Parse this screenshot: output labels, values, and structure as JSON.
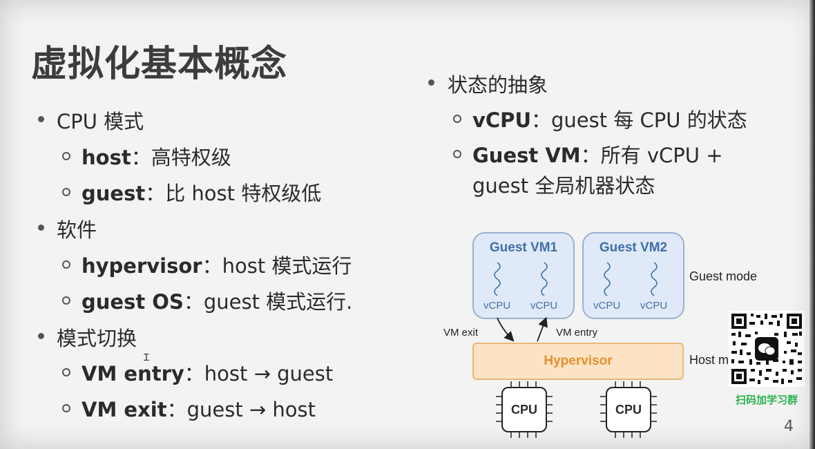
{
  "title": "虚拟化基本概念",
  "left_list": {
    "cpu_mode": "CPU 模式",
    "host_term": "host",
    "host_desc": "：高特权级",
    "guest_term": "guest",
    "guest_desc": "：比 host 特权级低",
    "software": "软件",
    "hypervisor_term": "hypervisor",
    "hypervisor_desc": "：host 模式运行",
    "guestos_term": "guest OS",
    "guestos_desc": "：guest 模式运行.",
    "mode_switch": "模式切换",
    "vmentry_term": "VM entry",
    "vmentry_desc": "：host → guest",
    "vmexit_term": "VM exit",
    "vmexit_desc": "：guest → host"
  },
  "right_list": {
    "state_abstraction": "状态的抽象",
    "vcpu_term": "vCPU",
    "vcpu_desc": "：guest 每 CPU 的状态",
    "guestvm_term": "Guest VM",
    "guestvm_desc": "：所有 vCPU +",
    "guestvm_desc2": "guest 全局机器状态"
  },
  "diagram": {
    "vm1": "Guest VM1",
    "vm2": "Guest VM2",
    "vcpu": "vCPU",
    "guest_mode": "Guest mode",
    "host_mode": "Host m",
    "vm_exit": "VM exit",
    "vm_entry": "VM entry",
    "hypervisor": "Hypervisor",
    "cpu": "CPU"
  },
  "qr_caption": "扫码加学习群",
  "page_number": "4",
  "colors": {
    "vm_fill": "#dfe9f7",
    "hypervisor_fill": "#fbe3c4",
    "hypervisor_text": "#e6902b",
    "qr_caption": "#2bb24c"
  }
}
